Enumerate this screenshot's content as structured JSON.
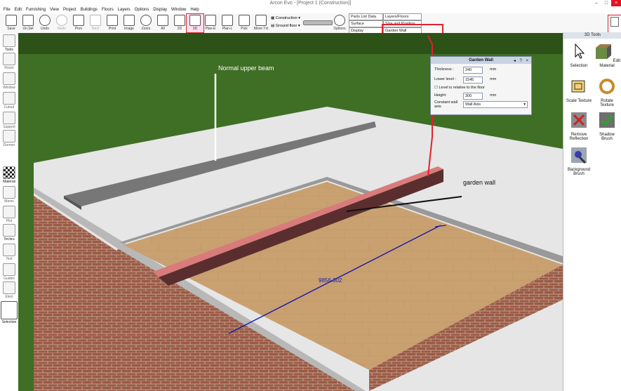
{
  "window": {
    "title": "Arcon Evo - [Project 1 (Construction)]"
  },
  "menu": [
    "File",
    "Edit",
    "Furnishing",
    "View",
    "Project",
    "Buildings",
    "Floors",
    "Layers",
    "Options",
    "Display",
    "Window",
    "Help"
  ],
  "toolbar": {
    "buttons": [
      "Save",
      "Un.Sel",
      "Undo",
      "Redo",
      "Prev",
      "Next",
      "Print",
      "Image",
      "Zoom",
      "All",
      "2D",
      "3D",
      "Plan-E",
      "Plan-L",
      "Pick",
      "Move Txt"
    ],
    "construction_label": "Construction",
    "floor_label": "Ground floor",
    "options_label": "Options"
  },
  "properties": [
    "Parts List Data",
    "Layers/Floors",
    "Surface",
    "Size and Position",
    "Display",
    "Garden Wall"
  ],
  "left_tools": [
    "Tools",
    "Room",
    "Window",
    "Cutout",
    "Support",
    "Dormer",
    "Material",
    "Mams",
    "Plot",
    "Ter.bru",
    "Text",
    "Guides",
    "Elect",
    "Selection"
  ],
  "right_panel": {
    "title": "3D Tools",
    "tools": [
      "Selection",
      "Edit Material",
      "Scale Texture",
      "Rotate Texture",
      "Remove Reflection",
      "Shadow Brush",
      "Background Brush"
    ]
  },
  "dialog": {
    "title": "Garden Wall",
    "thickness_label": "Thickness :",
    "thickness": "240",
    "lower_label": "Lower level :",
    "lower": "1545",
    "relative_label": "Level is relative to the floor",
    "height_label": "Height:",
    "height": "300",
    "axis_label": "Constant wall axis",
    "axis": "Wall Axis",
    "unit": "mm"
  },
  "annotations": {
    "beam": "Normal upper beam",
    "garden": "garden wall",
    "dimension": "9856.302"
  },
  "colors": {
    "accent_red": "#e0212d",
    "wall_red": "#c45a5a",
    "brick": "#9b5a45",
    "grass": "#3f6e25"
  }
}
